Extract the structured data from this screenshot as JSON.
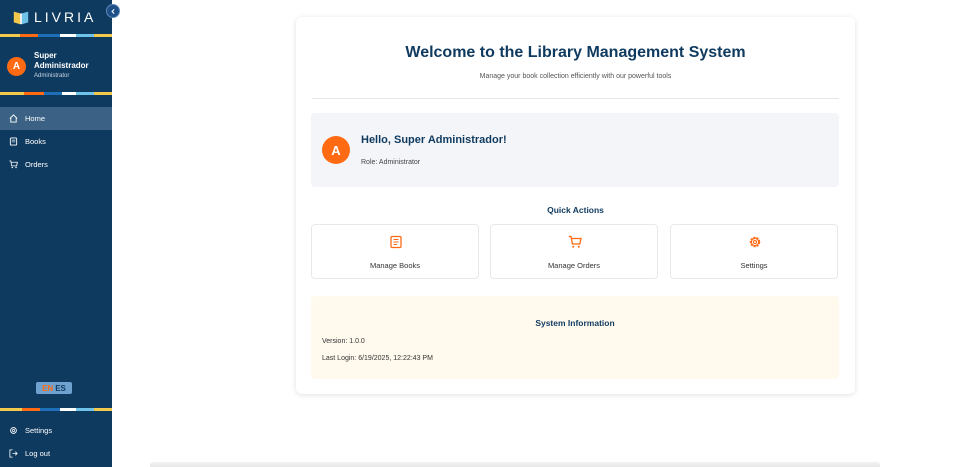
{
  "brand": {
    "name": "LIVRIA"
  },
  "sidebar": {
    "user": {
      "initial": "A",
      "name": "Super Administrador",
      "role": "Administrator"
    },
    "items": [
      {
        "label": "Home",
        "icon": "home-icon",
        "active": true
      },
      {
        "label": "Books",
        "icon": "book-icon",
        "active": false
      },
      {
        "label": "Orders",
        "icon": "cart-icon",
        "active": false
      }
    ],
    "language": {
      "en": "EN",
      "es": "ES",
      "selected": "EN"
    },
    "bottom_items": [
      {
        "label": "Settings",
        "icon": "gear-icon"
      },
      {
        "label": "Log out",
        "icon": "logout-icon"
      }
    ]
  },
  "main": {
    "title": "Welcome to the Library Management System",
    "subtitle": "Manage your book collection efficiently with our powerful tools",
    "greeting": {
      "initial": "A",
      "text": "Hello, Super Administrador!",
      "role": "Role: Administrator"
    },
    "quick_actions": {
      "title": "Quick Actions",
      "items": [
        {
          "label": "Manage Books",
          "icon": "book-icon"
        },
        {
          "label": "Manage Orders",
          "icon": "cart-icon"
        },
        {
          "label": "Settings",
          "icon": "gear-icon"
        }
      ]
    },
    "system_info": {
      "title": "System Information",
      "version": "Version: 1.0.0",
      "last_login": "Last Login: 6/19/2025, 12:22:43 PM"
    }
  },
  "colors": {
    "sidebar_bg": "#0f3a5f",
    "accent": "#ff6a13",
    "active_item": "#3b6285",
    "heading": "#0f3a5f",
    "system_bg": "#fff9ee"
  }
}
